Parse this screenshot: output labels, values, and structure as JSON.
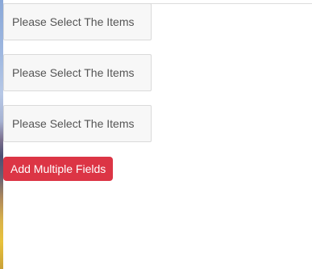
{
  "fields": [
    {
      "placeholder": "Please Select The Items"
    },
    {
      "placeholder": "Please Select The Items"
    },
    {
      "placeholder": "Please Select The Items"
    }
  ],
  "actions": {
    "add_label": "Add Multiple Fields"
  },
  "colors": {
    "button_bg": "#dc3545",
    "field_bg": "#f7f7f7",
    "field_border": "#dadada"
  }
}
